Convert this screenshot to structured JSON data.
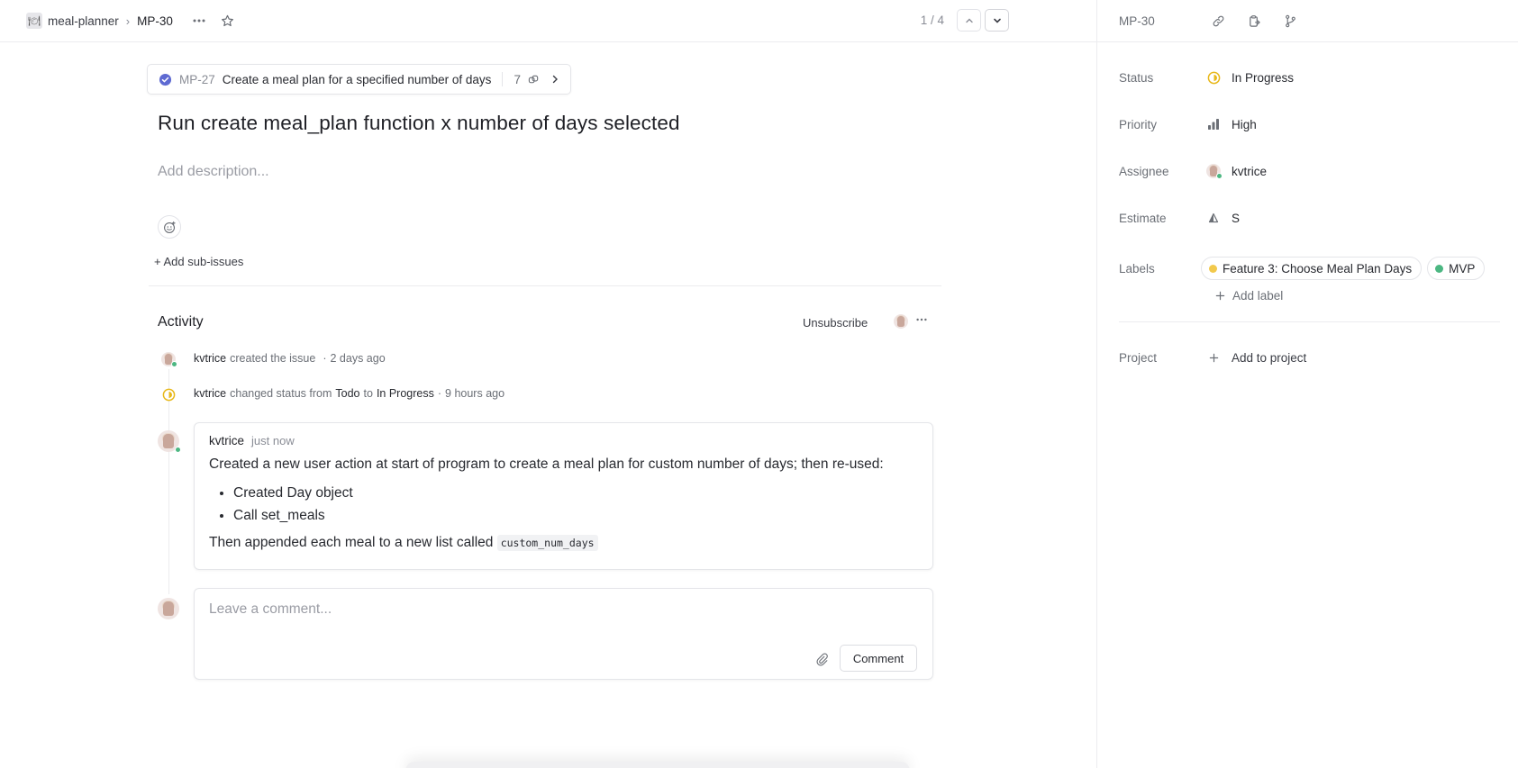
{
  "breadcrumb": {
    "project_icon": "plate-icon",
    "project": "meal-planner",
    "separator": "›",
    "current": "MP-30"
  },
  "pager": {
    "text": "1 / 4"
  },
  "parent": {
    "id": "MP-27",
    "title": "Create a meal plan for a specified number of days",
    "count": "7"
  },
  "issue": {
    "title": "Run create meal_plan function x number of days selected",
    "description_placeholder": "Add description...",
    "add_sub_issues": "+ Add sub-issues"
  },
  "activity": {
    "title": "Activity",
    "unsubscribe": "Unsubscribe",
    "events": [
      {
        "actor": "kvtrice",
        "action": "created the issue",
        "sep": "·",
        "time": "2 days ago"
      },
      {
        "actor": "kvtrice",
        "action": "changed status from",
        "from": "Todo",
        "to_word": "to",
        "to": "In Progress",
        "sep": "·",
        "time": "9 hours ago"
      }
    ],
    "comment": {
      "author": "kvtrice",
      "time": "just now",
      "intro": "Created a new user action at start of program to create a meal plan for custom number of days; then re-used:",
      "bullets": [
        "Created Day object",
        "Call set_meals"
      ],
      "outro": "Then appended each meal to a new list called",
      "code": "custom_num_days"
    },
    "new_comment": {
      "placeholder": "Leave a comment...",
      "button": "Comment"
    }
  },
  "sidebar": {
    "id": "MP-30",
    "status": {
      "label": "Status",
      "value": "In Progress",
      "color": "#f2c94c"
    },
    "priority": {
      "label": "Priority",
      "value": "High"
    },
    "assignee": {
      "label": "Assignee",
      "value": "kvtrice"
    },
    "estimate": {
      "label": "Estimate",
      "value": "S"
    },
    "labels": {
      "label": "Labels",
      "items": [
        {
          "name": "Feature 3: Choose Meal Plan Days",
          "color": "#f2c94c"
        },
        {
          "name": "MVP",
          "color": "#4cb782"
        }
      ],
      "add": "Add label"
    },
    "project": {
      "label": "Project",
      "value": "Add to project"
    }
  }
}
